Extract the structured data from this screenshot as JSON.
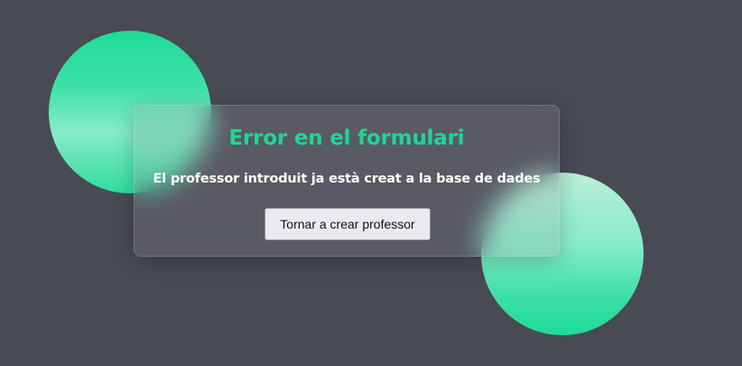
{
  "dialog": {
    "title": "Error en el formulari",
    "message": "El professor introduit ja està creat a la base de dades",
    "button_label": "Tornar a crear professor"
  },
  "colors": {
    "background": "#484a54",
    "accent": "#1fd596",
    "circle_gradient_start": "#1fdb98",
    "circle_gradient_light": "#86ecca",
    "button_background": "#ebebef"
  }
}
